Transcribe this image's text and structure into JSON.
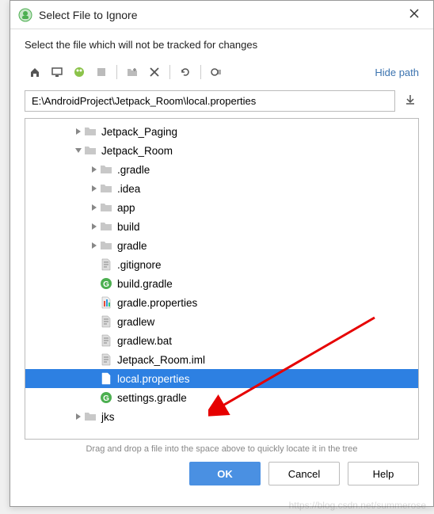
{
  "title": "Select File to Ignore",
  "subtitle": "Select the file which will not be tracked for changes",
  "hide_path_label": "Hide path",
  "path_value": "E:\\AndroidProject\\Jetpack_Room\\local.properties",
  "tree": [
    {
      "depth": 2,
      "arrow": "collapsed",
      "icon": "folder",
      "label": "Jetpack_Paging"
    },
    {
      "depth": 2,
      "arrow": "expanded",
      "icon": "folder",
      "label": "Jetpack_Room"
    },
    {
      "depth": 3,
      "arrow": "collapsed",
      "icon": "folder",
      "label": ".gradle"
    },
    {
      "depth": 3,
      "arrow": "collapsed",
      "icon": "folder",
      "label": ".idea"
    },
    {
      "depth": 3,
      "arrow": "collapsed",
      "icon": "folder",
      "label": "app"
    },
    {
      "depth": 3,
      "arrow": "collapsed",
      "icon": "folder",
      "label": "build"
    },
    {
      "depth": 3,
      "arrow": "collapsed",
      "icon": "folder",
      "label": "gradle"
    },
    {
      "depth": 3,
      "arrow": "none",
      "icon": "file",
      "label": ".gitignore"
    },
    {
      "depth": 3,
      "arrow": "none",
      "icon": "gradle",
      "label": "build.gradle"
    },
    {
      "depth": 3,
      "arrow": "none",
      "icon": "props",
      "label": "gradle.properties"
    },
    {
      "depth": 3,
      "arrow": "none",
      "icon": "file",
      "label": "gradlew"
    },
    {
      "depth": 3,
      "arrow": "none",
      "icon": "file",
      "label": "gradlew.bat"
    },
    {
      "depth": 3,
      "arrow": "none",
      "icon": "file",
      "label": "Jetpack_Room.iml"
    },
    {
      "depth": 3,
      "arrow": "none",
      "icon": "props",
      "label": "local.properties",
      "selected": true
    },
    {
      "depth": 3,
      "arrow": "none",
      "icon": "gradle",
      "label": "settings.gradle"
    },
    {
      "depth": 2,
      "arrow": "collapsed",
      "icon": "folder",
      "label": "jks",
      "partial": true
    }
  ],
  "hint": "Drag and drop a file into the space above to quickly locate it in the tree",
  "buttons": {
    "ok": "OK",
    "cancel": "Cancel",
    "help": "Help"
  },
  "watermark": "https://blog.csdn.net/summerose"
}
